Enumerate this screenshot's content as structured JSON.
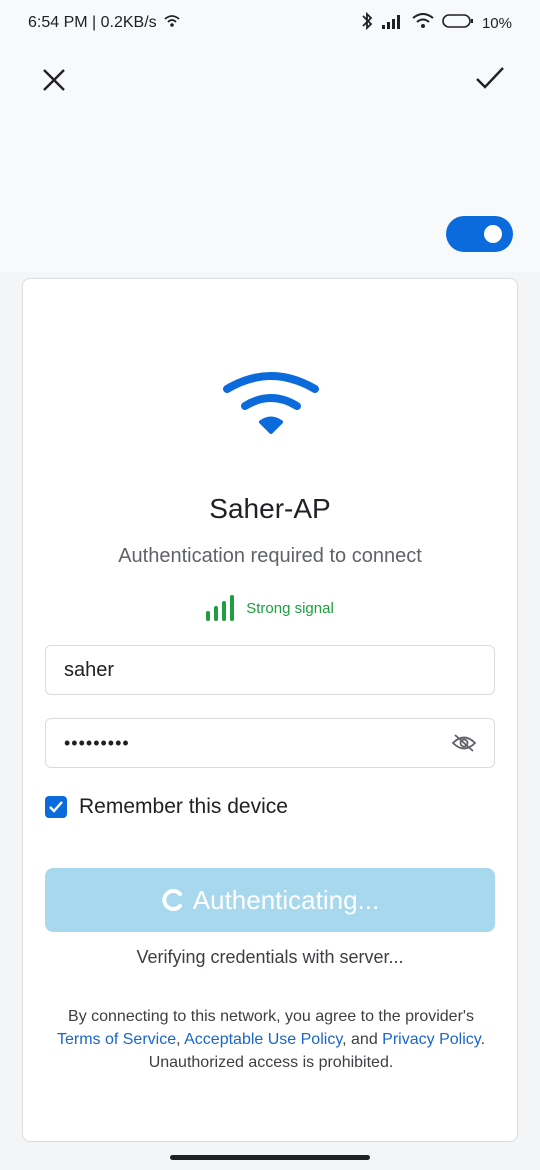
{
  "status_bar": {
    "time_speed": "6:54 PM | 0.2KB/s",
    "battery": "10%"
  },
  "toolbar": {
    "close_icon": "close-icon",
    "confirm_icon": "check-icon",
    "toggle_on": true
  },
  "network": {
    "name": "Saher-AP",
    "subtitle": "Authentication required to connect",
    "signal_text": "Strong signal"
  },
  "form": {
    "username_value": "saher",
    "password_value": "•••••••••",
    "remember_label": "Remember this device",
    "remember_checked": true
  },
  "button": {
    "label": "Authenticating..."
  },
  "status_text": "Verifying credentials with server...",
  "legal": {
    "prefix": "By connecting to this network, you agree to the provider's",
    "terms": "Terms of Service",
    "sep1": ",",
    "aup": "Acceptable Use Policy",
    "sep2": ", and",
    "privacy": "Privacy Policy",
    "sep3": ".",
    "suffix": "Unauthorized access is prohibited."
  },
  "colors": {
    "accent": "#0b6bdc",
    "signal": "#1e9e3e",
    "button_disabled": "#a8d8ee",
    "link": "#1a66c9"
  }
}
